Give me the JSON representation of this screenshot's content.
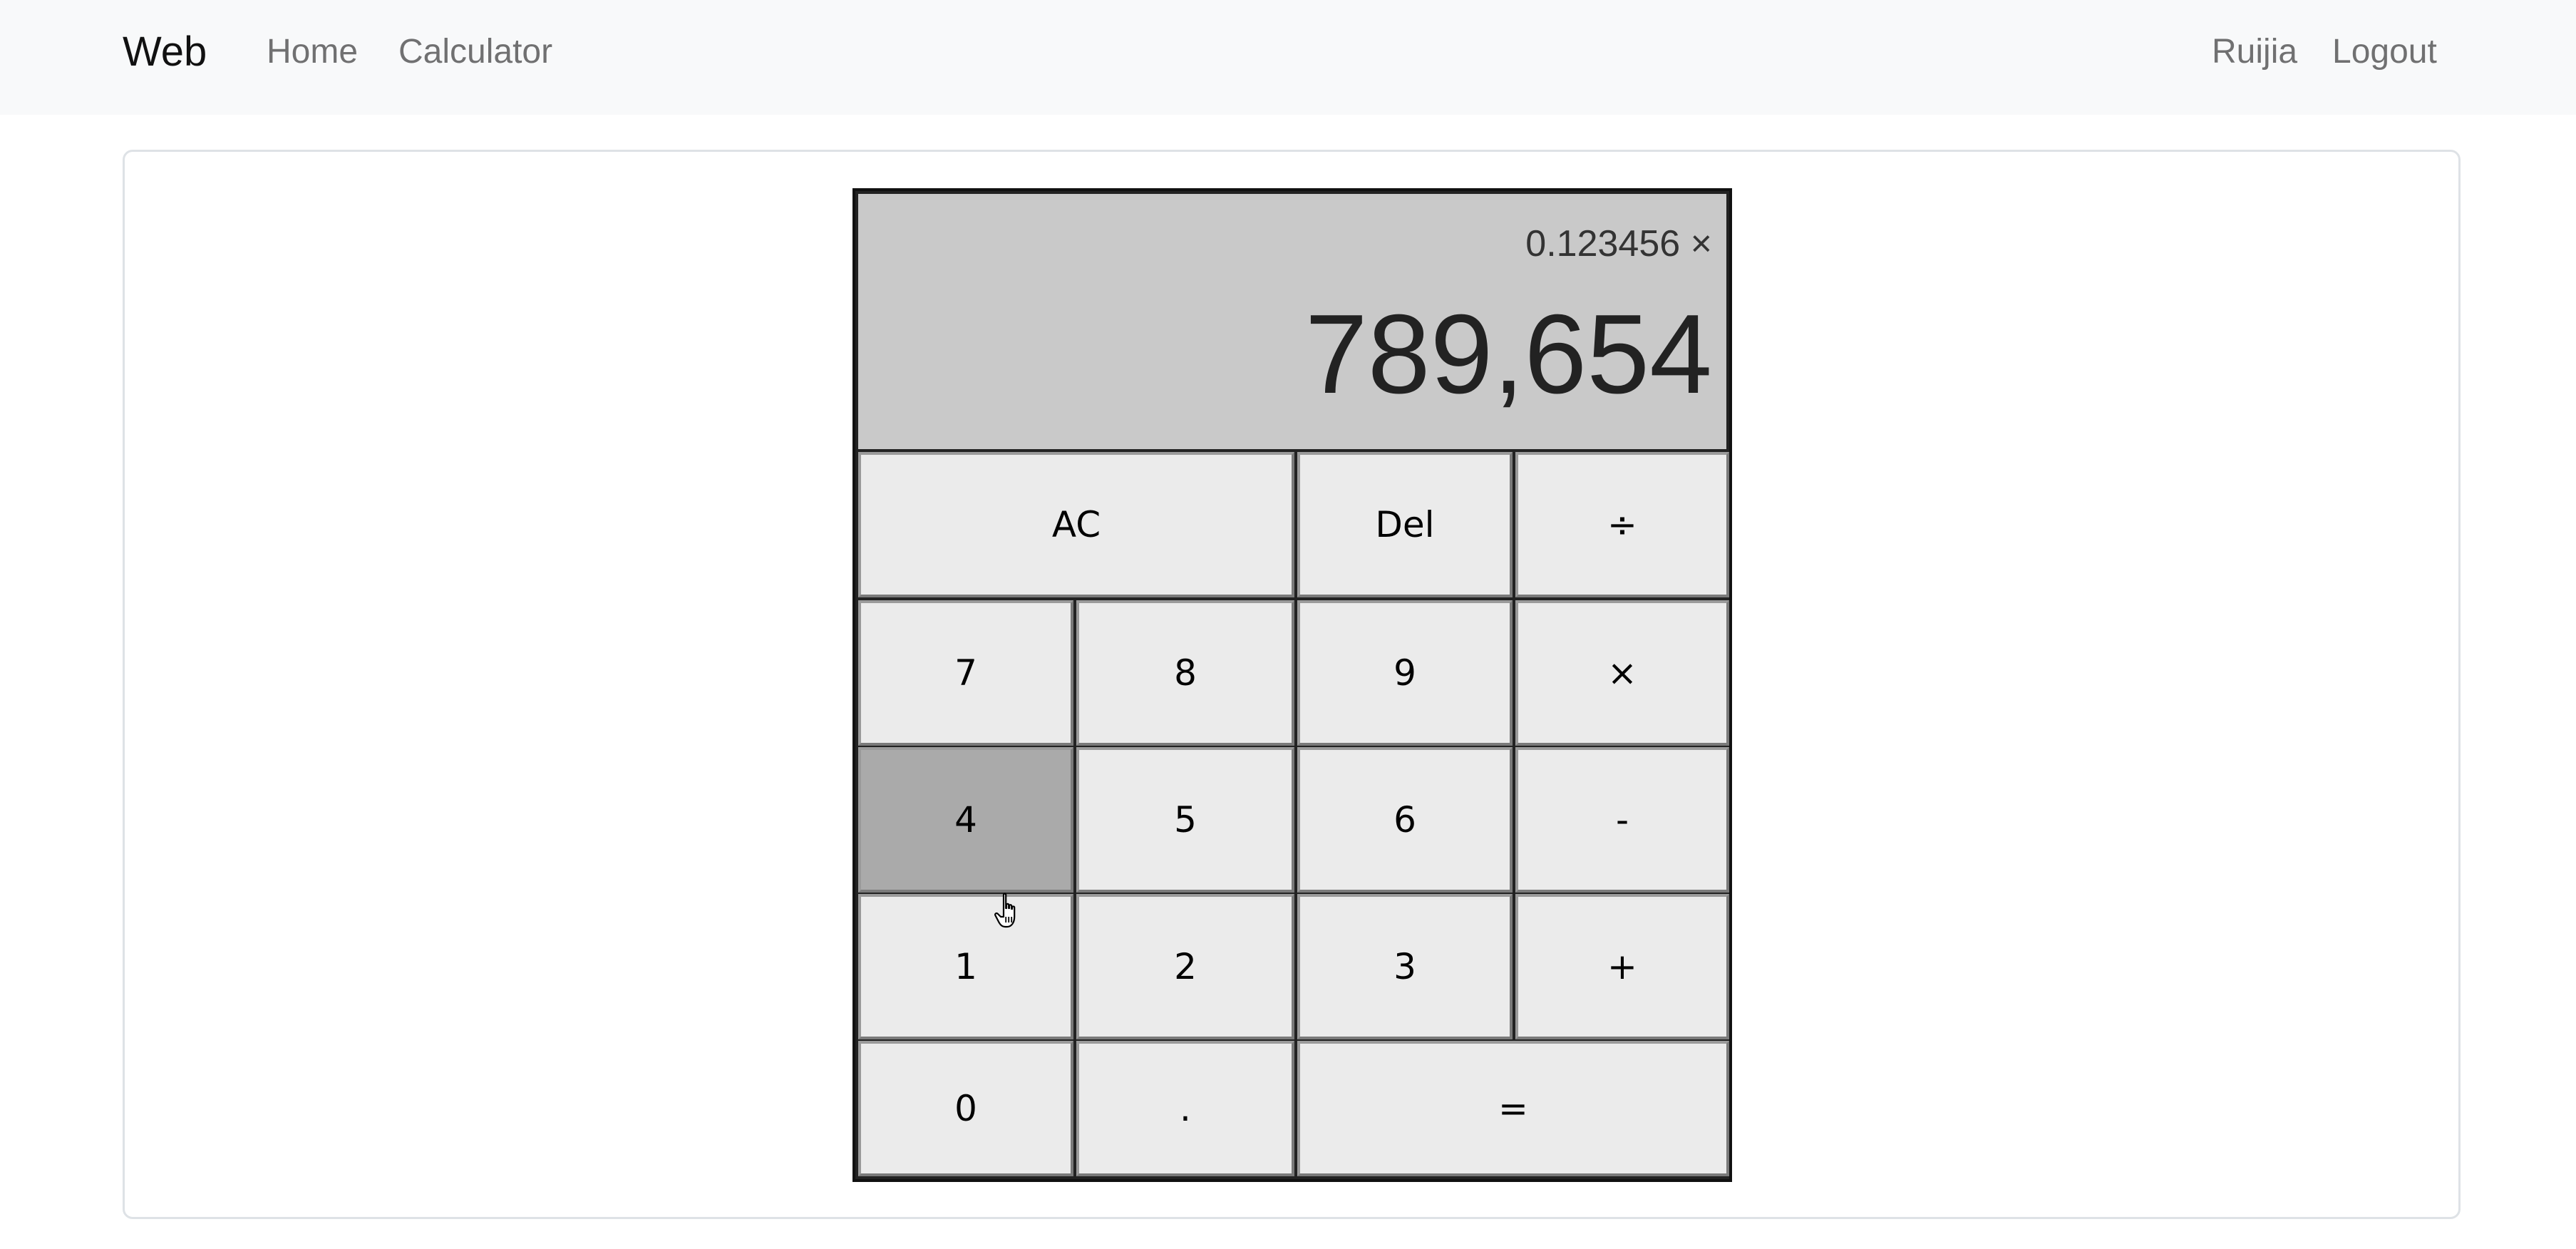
{
  "navbar": {
    "brand": "Web",
    "links": [
      "Home",
      "Calculator"
    ],
    "user": "Ruijia",
    "logout": "Logout"
  },
  "calculator": {
    "previous_operand": "0.123456 ×",
    "current_operand": "789,654",
    "keys": {
      "ac": "AC",
      "del": "Del",
      "divide": "÷",
      "seven": "7",
      "eight": "8",
      "nine": "9",
      "multiply": "×",
      "four": "4",
      "five": "5",
      "six": "6",
      "minus": "-",
      "one": "1",
      "two": "2",
      "three": "3",
      "plus": "+",
      "zero": "0",
      "dot": ".",
      "equals": "="
    },
    "pressed_key": "4"
  },
  "colors": {
    "navbar_bg": "#f8f9fa",
    "display_bg": "#c9c9c9",
    "key_bg": "#ebebeb",
    "key_pressed_bg": "#aaaaaa"
  },
  "cursor": "hand-pointer-icon"
}
